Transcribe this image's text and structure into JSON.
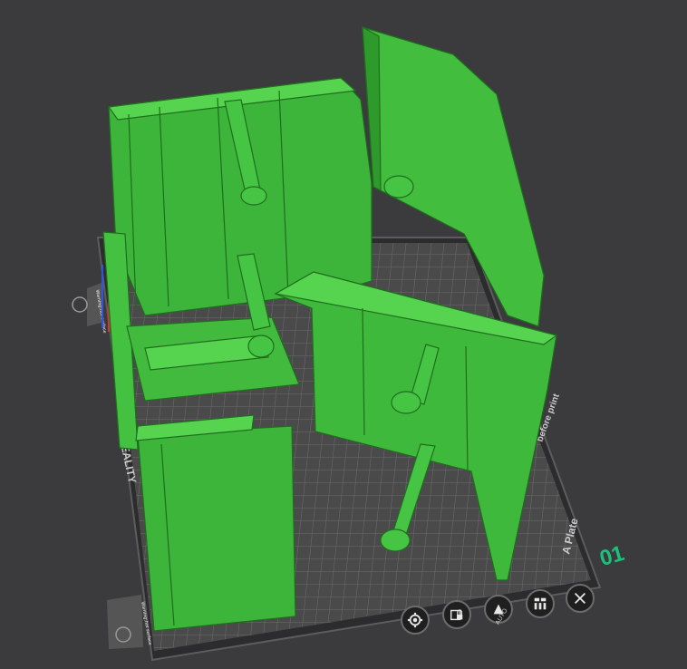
{
  "viewport": {
    "plate_brand": "CREALITY",
    "plate_name": "A Plate",
    "plate_number": "01",
    "plate_side_note": "before print",
    "warning_label": "Warning:hot surface",
    "model_color": "#3cb53a",
    "background_color": "#3b3b3d",
    "accent_color": "#19c27c"
  },
  "plate_toolbar": {
    "buttons": [
      {
        "name": "settings-button",
        "icon": "gear-icon"
      },
      {
        "name": "lock-plate-button",
        "icon": "lock-icon"
      },
      {
        "name": "auto-orient-button",
        "icon": "auto-orient-icon",
        "tag": "AUTO"
      },
      {
        "name": "arrange-button",
        "icon": "arrange-icon"
      },
      {
        "name": "delete-plate-button",
        "icon": "close-icon"
      }
    ]
  }
}
